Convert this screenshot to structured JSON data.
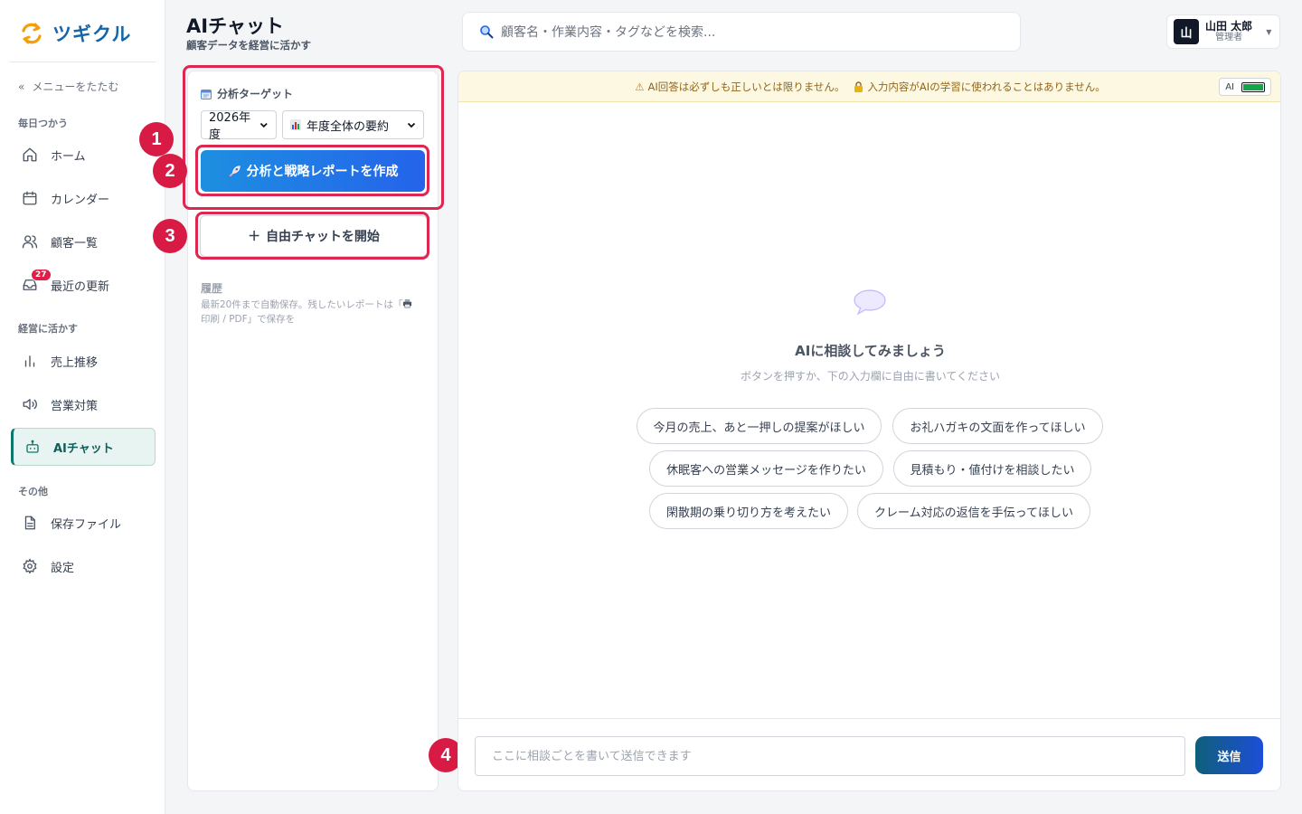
{
  "app": {
    "name": "ツギクル"
  },
  "sidebar": {
    "collapse_label": "メニューをたたむ",
    "collapse_icon": "«",
    "sections": {
      "daily": "毎日つかう",
      "business": "経営に活かす",
      "other": "その他"
    },
    "items": {
      "home": "ホーム",
      "calendar": "カレンダー",
      "customers": "顧客一覧",
      "updates": "最近の更新",
      "updates_badge": "27",
      "sales": "売上推移",
      "marketing": "営業対策",
      "ai_chat": "AIチャット",
      "files": "保存ファイル",
      "settings": "設定"
    }
  },
  "header": {
    "title": "AIチャット",
    "subtitle": "顧客データを経営に活かす",
    "search_placeholder": "顧客名・作業内容・タグなどを検索..."
  },
  "user": {
    "avatar": "山",
    "name": "山田 太郎",
    "role": "管理者"
  },
  "left_panel": {
    "target_label": "分析ターゲット",
    "year_select": "2026年度",
    "scope_select": "年度全体の要約",
    "report_button": "分析と戦略レポートを作成",
    "free_chat_button": "自由チャットを開始",
    "history_title": "履歴",
    "history_note_1": "最新20件まで自動保存。残したいレポートは「",
    "history_note_2": "印刷 / PDF」で保存を"
  },
  "markers": {
    "m1": "1",
    "m2": "2",
    "m3": "3",
    "m4": "4"
  },
  "chat": {
    "notice_1": "AI回答は必ずしも正しいとは限りません。",
    "notice_2": "入力内容がAIの学習に使われることはありません。",
    "ai_indicator": "AI",
    "empty_title": "AIに相談してみましょう",
    "empty_subtitle": "ボタンを押すか、下の入力欄に自由に書いてください",
    "suggestions": [
      "今月の売上、あと一押しの提案がほしい",
      "お礼ハガキの文面を作ってほしい",
      "休眠客への営業メッセージを作りたい",
      "見積もり・値付けを相談したい",
      "閑散期の乗り切り方を考えたい",
      "クレーム対応の返信を手伝ってほしい"
    ],
    "input_placeholder": "ここに相談ごとを書いて送信できます",
    "send_label": "送信"
  },
  "colors": {
    "brand": "#1565a8",
    "accent_teal": "#0f766e",
    "highlight": "#dc2750",
    "primary_button": "#2563eb"
  }
}
